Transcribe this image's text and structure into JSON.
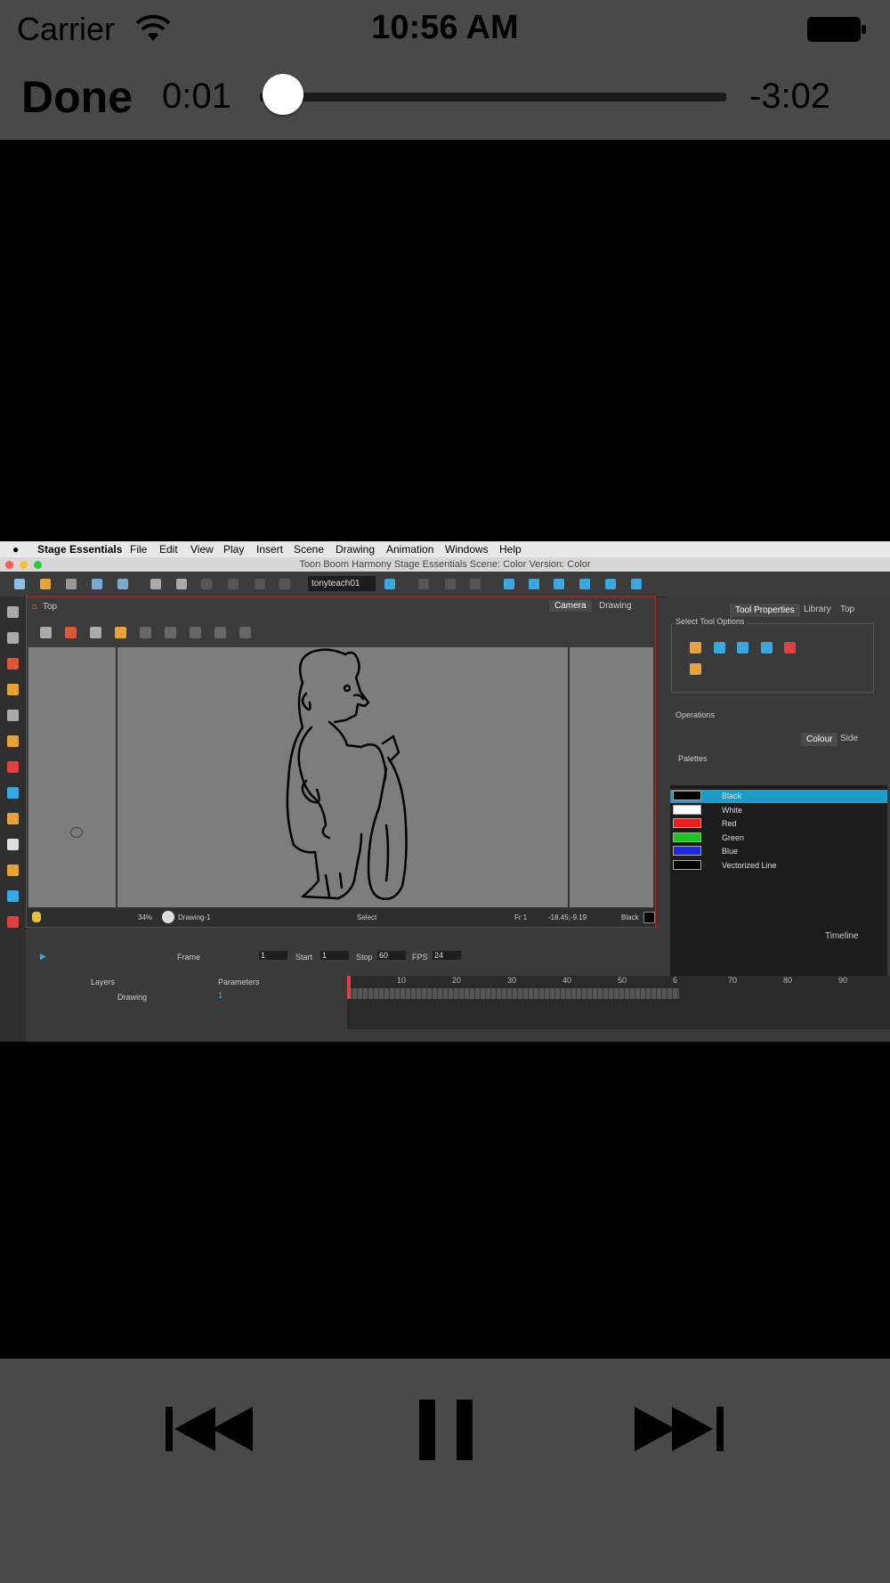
{
  "status": {
    "carrier": "Carrier",
    "time": "10:56 AM"
  },
  "player": {
    "done_label": "Done",
    "elapsed": "0:01",
    "remaining": "-3:02",
    "progress": 0.005
  },
  "video": {
    "menubar": [
      "Stage Essentials",
      "File",
      "Edit",
      "View",
      "Play",
      "Insert",
      "Scene",
      "Drawing",
      "Animation",
      "Windows",
      "Help"
    ],
    "window_title": "Toon Boom Harmony Stage Essentials Scene: Color Version: Color",
    "scene_select": "tonyteach01",
    "camera_panel": {
      "breadcrumb": "Top",
      "tabs": [
        "Camera",
        "Drawing"
      ],
      "zoom": "34%",
      "drawing_name": "Drawing-1",
      "tool": "Select",
      "frame": "Fr 1",
      "coords": "-18.45;-9.19",
      "colour": "Black"
    },
    "tool_properties": {
      "tabs": [
        "Tool Properties",
        "Library",
        "Top"
      ],
      "section": "Select Tool Options",
      "operations": "Operations"
    },
    "colour_panel": {
      "tabs": [
        "Colour",
        "Side"
      ],
      "palettes_label": "Palettes",
      "swatches": [
        {
          "name": "Black",
          "color": "#000000",
          "selected": true
        },
        {
          "name": "White",
          "color": "#ffffff"
        },
        {
          "name": "Red",
          "color": "#e82020"
        },
        {
          "name": "Green",
          "color": "#20c020"
        },
        {
          "name": "Blue",
          "color": "#1a28e0"
        },
        {
          "name": "Vectorized Line",
          "color": "#000000"
        }
      ]
    },
    "timeline": {
      "title": "Timeline",
      "frame_label": "Frame",
      "frame_value": "1",
      "start_label": "Start",
      "start_value": "1",
      "stop_label": "Stop",
      "stop_value": "60",
      "fps_label": "FPS",
      "fps_value": "24",
      "layers_label": "Layers",
      "parameters_label": "Parameters",
      "layer_name": "Drawing",
      "layer_param": "1",
      "ruler": [
        "10",
        "20",
        "30",
        "40",
        "50",
        "6",
        "70",
        "80",
        "90"
      ]
    }
  },
  "controls": {
    "prev": "previous-track",
    "pause": "pause",
    "next": "next-track"
  }
}
